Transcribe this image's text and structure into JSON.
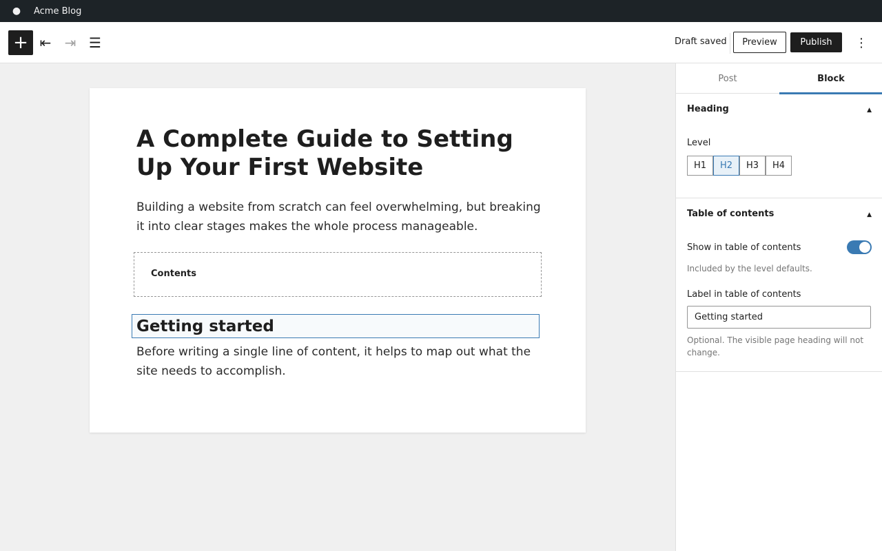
{
  "adminbar": {
    "logo_icon": "wordpress-icon",
    "site_name": "Acme Blog"
  },
  "toolbar": {
    "inserter_icon": "+",
    "undo_icon": "⇤",
    "redo_icon": "⇥",
    "list_view_icon": "☰",
    "status": "Draft saved",
    "preview_label": "Preview",
    "publish_label": "Publish",
    "more_icon": "⋮"
  },
  "post": {
    "title": "A Complete Guide to Setting Up Your First Website",
    "intro": "Building a website from scratch can feel overwhelming, but breaking it into clear stages makes the whole process manageable.",
    "toc_title": "Contents",
    "selected_heading": "Getting started",
    "body": "Before writing a single line of content, it helps to map out what the site needs to accomplish."
  },
  "sidebar": {
    "tabs": [
      {
        "label": "Post",
        "active": false
      },
      {
        "label": "Block",
        "active": true
      }
    ],
    "heading_panel": {
      "title": "Heading",
      "level_label": "Level",
      "levels": [
        "H1",
        "H2",
        "H3",
        "H4"
      ],
      "selected_level": "H2"
    },
    "toc_panel": {
      "title": "Table of contents",
      "show_label": "Show in table of contents",
      "show_enabled": true,
      "show_help": "Included by the level defaults.",
      "label_field_label": "Label in table of contents",
      "label_value": "Getting started",
      "label_help": "Optional. The visible page heading will not change."
    }
  },
  "colors": {
    "accent": "#3a7ab3",
    "adminbar": "#1d2327",
    "dark": "#1e1e1e"
  }
}
